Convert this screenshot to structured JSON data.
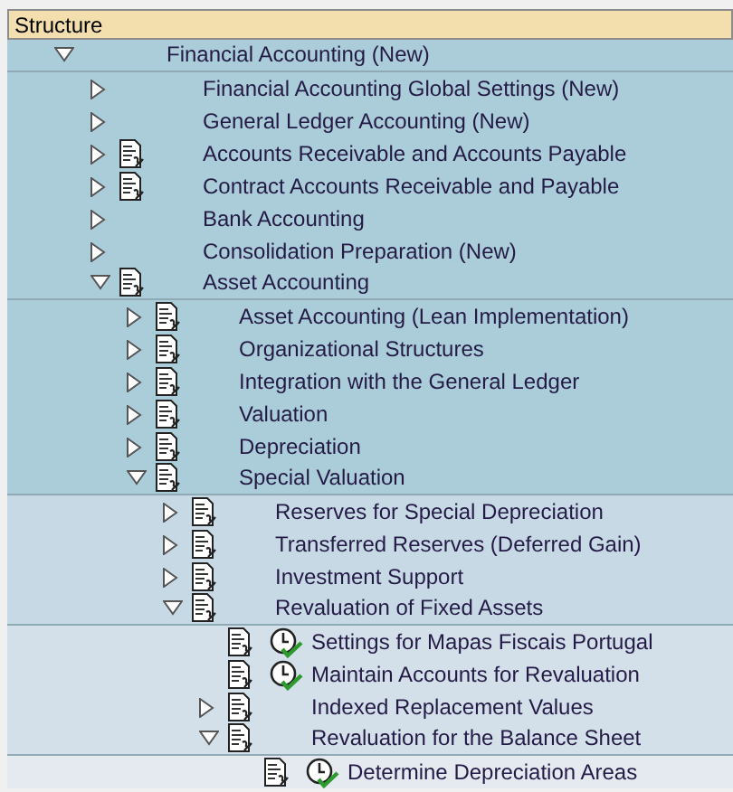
{
  "header": {
    "title": "Structure"
  },
  "tree": [
    {
      "label": "Financial Accounting (New)",
      "kind": "folder",
      "expanded": true,
      "children": [
        {
          "label": "Financial Accounting Global Settings (New)",
          "kind": "folder",
          "expanded": false
        },
        {
          "label": "General Ledger Accounting (New)",
          "kind": "folder",
          "expanded": false
        },
        {
          "label": "Accounts Receivable and Accounts Payable",
          "kind": "documented",
          "expanded": false
        },
        {
          "label": "Contract Accounts Receivable and Payable",
          "kind": "documented",
          "expanded": false
        },
        {
          "label": "Bank Accounting",
          "kind": "folder",
          "expanded": false
        },
        {
          "label": "Consolidation Preparation (New)",
          "kind": "folder",
          "expanded": false
        },
        {
          "label": "Asset Accounting",
          "kind": "documented",
          "expanded": true,
          "children": [
            {
              "label": "Asset Accounting (Lean Implementation)",
              "kind": "documented",
              "expanded": false
            },
            {
              "label": "Organizational Structures",
              "kind": "documented",
              "expanded": false
            },
            {
              "label": "Integration with the General Ledger",
              "kind": "documented",
              "expanded": false
            },
            {
              "label": "Valuation",
              "kind": "documented",
              "expanded": false
            },
            {
              "label": "Depreciation",
              "kind": "documented",
              "expanded": false
            },
            {
              "label": "Special Valuation",
              "kind": "documented",
              "expanded": true,
              "children": [
                {
                  "label": "Reserves for Special Depreciation",
                  "kind": "documented",
                  "expanded": false
                },
                {
                  "label": "Transferred Reserves (Deferred Gain)",
                  "kind": "documented",
                  "expanded": false
                },
                {
                  "label": "Investment Support",
                  "kind": "documented",
                  "expanded": false
                },
                {
                  "label": "Revaluation of Fixed Assets",
                  "kind": "documented",
                  "expanded": true,
                  "children": [
                    {
                      "label": "Settings for Mapas Fiscais Portugal",
                      "kind": "activity"
                    },
                    {
                      "label": "Maintain Accounts for Revaluation",
                      "kind": "activity"
                    },
                    {
                      "label": "Indexed Replacement Values",
                      "kind": "documented",
                      "expanded": false
                    },
                    {
                      "label": "Revaluation for the Balance Sheet",
                      "kind": "documented",
                      "expanded": true,
                      "children": [
                        {
                          "label": "Determine Depreciation Areas",
                          "kind": "activity"
                        }
                      ]
                    }
                  ]
                }
              ]
            }
          ]
        }
      ]
    }
  ]
}
